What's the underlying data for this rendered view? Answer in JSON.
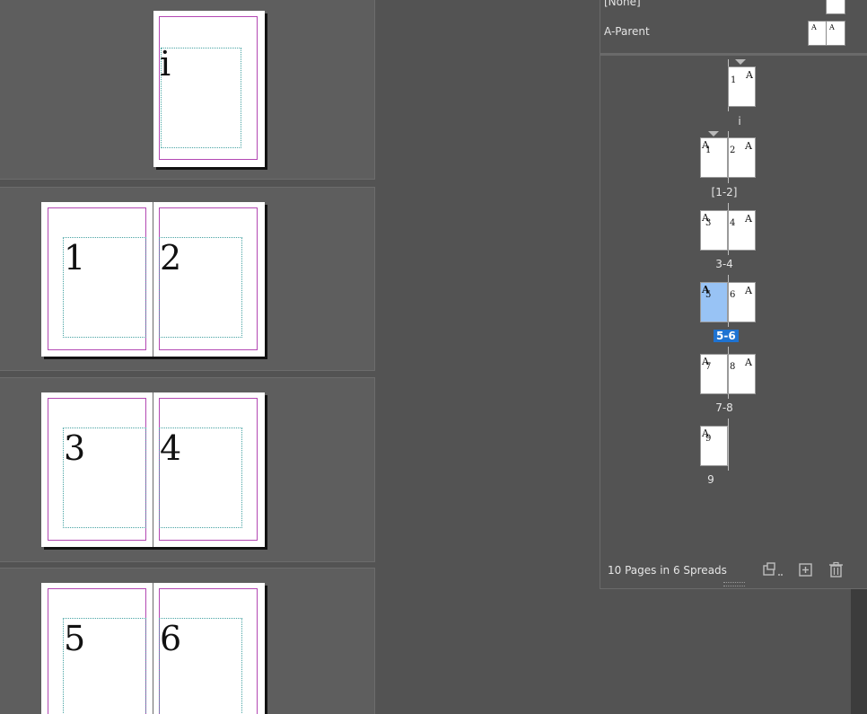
{
  "canvas": {
    "page_numbers": [
      "i",
      "1",
      "2",
      "3",
      "4",
      "5",
      "6"
    ]
  },
  "pages_panel": {
    "parents": [
      {
        "label": "[None]"
      },
      {
        "label": "A-Parent",
        "thumb_letters": [
          "A",
          "A"
        ]
      }
    ],
    "spreads": [
      {
        "label": "i",
        "pages": [
          "1"
        ],
        "parent_letters": [
          "A"
        ]
      },
      {
        "label": "[1-2]",
        "pages": [
          "1",
          "2"
        ],
        "parent_letters": [
          "A",
          "A"
        ]
      },
      {
        "label": "3-4",
        "pages": [
          "3",
          "4"
        ],
        "parent_letters": [
          "A",
          "A"
        ]
      },
      {
        "label": "5-6",
        "pages": [
          "5",
          "6"
        ],
        "parent_letters": [
          "A",
          "A"
        ],
        "selected": true
      },
      {
        "label": "7-8",
        "pages": [
          "7",
          "8"
        ],
        "parent_letters": [
          "A",
          "A"
        ]
      },
      {
        "label": "9",
        "pages": [
          "9"
        ],
        "parent_letters": [
          "A"
        ]
      }
    ],
    "footer": {
      "count_text": "10 Pages in 6 Spreads",
      "icons": [
        "edit-page-size-icon",
        "new-page-icon",
        "delete-page-icon"
      ]
    }
  },
  "colors": {
    "selection": "#1e73d2",
    "selected_page": "#98c3f5",
    "margin_guide": "#b348b3",
    "frame_guide": "#47a3a3"
  }
}
